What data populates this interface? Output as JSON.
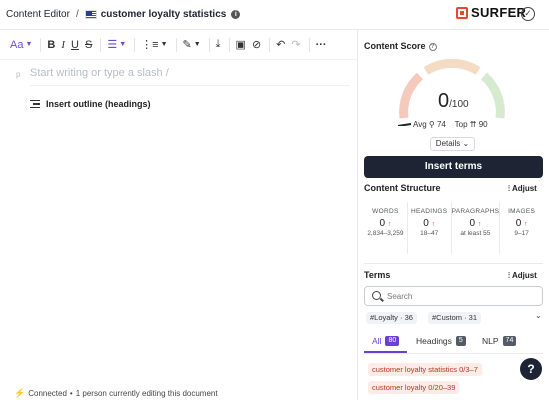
{
  "header": {
    "breadcrumb_root": "Content Editor",
    "breadcrumb_separator": "/",
    "document_title": "customer loyalty statistics",
    "brand_name": "SURFER",
    "icons": [
      "us-flag-icon",
      "info-icon",
      "surfer-logo-icon",
      "check-circle-icon"
    ]
  },
  "toolbar": {
    "font_style_label": "Aa",
    "buttons": [
      "font-style",
      "bold",
      "italic",
      "underline",
      "strikethrough",
      "align",
      "list",
      "highlight",
      "clear-format",
      "image",
      "link",
      "undo",
      "redo",
      "more"
    ]
  },
  "editor": {
    "paragraph_marker": "p",
    "placeholder": "Start writing or type a slash /",
    "insert_outline_label": "Insert outline (headings)"
  },
  "footer": {
    "status": "Connected",
    "editing_note": "1 person currently editing this document"
  },
  "panel": {
    "content_score_title": "Content Score",
    "score": "0",
    "score_max": "/100",
    "avg_label": "Avg",
    "avg_value": "74",
    "top_label": "Top",
    "top_value": "90",
    "details_label": "Details",
    "insert_terms_label": "Insert terms",
    "structure_title": "Content Structure",
    "adjust_label": "Adjust",
    "stats": [
      {
        "label": "WORDS",
        "value": "0",
        "range": "2,834–3,259"
      },
      {
        "label": "HEADINGS",
        "value": "0",
        "range": "18–47"
      },
      {
        "label": "PARAGRAPHS",
        "value": "0",
        "range": "at least 55"
      },
      {
        "label": "IMAGES",
        "value": "0",
        "range": "9–17"
      }
    ],
    "terms_title": "Terms",
    "search_placeholder": "Search",
    "chips": [
      "#Loyalty · 36",
      "#Custom · 31"
    ],
    "tabs": [
      {
        "label": "All",
        "count": "80"
      },
      {
        "label": "Headings",
        "count": "5"
      },
      {
        "label": "NLP",
        "count": "74"
      }
    ],
    "terms": [
      {
        "term": "customer loyalty statistics",
        "count": "0/3–7"
      },
      {
        "term": "customer loyalty",
        "count": "0/20–39"
      }
    ],
    "gauge_colors": [
      "#f6c9bd",
      "#f3dcc3",
      "#d6ead0"
    ],
    "accent_color": "#6b3fd1"
  },
  "help_label": "?"
}
